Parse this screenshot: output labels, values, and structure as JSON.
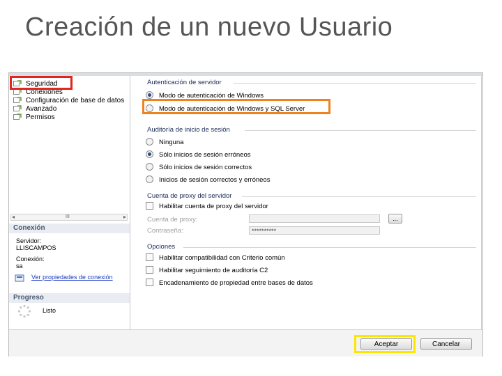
{
  "slide": {
    "title": "Creación de un nuevo Usuario"
  },
  "left_panel": {
    "pages": [
      {
        "label": "Seguridad",
        "highlighted": true
      },
      {
        "label": "Conexiones"
      },
      {
        "label": "Configuración de base de datos"
      },
      {
        "label": "Avanzado"
      },
      {
        "label": "Permisos"
      }
    ],
    "scrollbar_glyph": "III",
    "connection": {
      "header": "Conexión",
      "server_label": "Servidor:",
      "server_value": "LLISCAMPOS",
      "connection_label": "Conexión:",
      "connection_value": "sa",
      "link_text": "Ver propiedades de conexión"
    },
    "progress": {
      "header": "Progreso",
      "status": "Listo"
    }
  },
  "main": {
    "server_auth": {
      "group_label": "Autenticación de servidor",
      "options": [
        {
          "label": "Modo de autenticación de Windows",
          "selected": true
        },
        {
          "label": "Modo de autenticación de Windows y SQL Server",
          "selected": false,
          "highlighted": true
        }
      ]
    },
    "login_audit": {
      "group_label": "Auditoría de inicio de sesión",
      "options": [
        {
          "label": "Ninguna",
          "selected": false
        },
        {
          "label": "Sólo inicios de sesión erróneos",
          "selected": true
        },
        {
          "label": "Sólo inicios de sesión correctos",
          "selected": false
        },
        {
          "label": "Inicios de sesión correctos y erróneos",
          "selected": false
        }
      ]
    },
    "proxy": {
      "group_label": "Cuenta de proxy del servidor",
      "enable_label": "Habilitar cuenta de proxy del servidor",
      "proxy_account_label": "Cuenta de proxy:",
      "proxy_account_value": "",
      "browse_label": "...",
      "password_label": "Contraseña:",
      "password_value": "**********"
    },
    "options": {
      "group_label": "Opciones",
      "checks": [
        {
          "label": "Habilitar compatibilidad con Criterio común",
          "checked": false
        },
        {
          "label": "Habilitar seguimiento de auditoría C2",
          "checked": false
        },
        {
          "label": "Encadenamiento de propiedad entre bases de datos",
          "checked": false
        }
      ]
    }
  },
  "footer": {
    "ok_label": "Aceptar",
    "cancel_label": "Cancelar"
  },
  "colors": {
    "highlight_red": "#e0261f",
    "highlight_orange": "#f0821e",
    "highlight_yellow": "#ffe600",
    "link_blue": "#1a3cc4"
  }
}
